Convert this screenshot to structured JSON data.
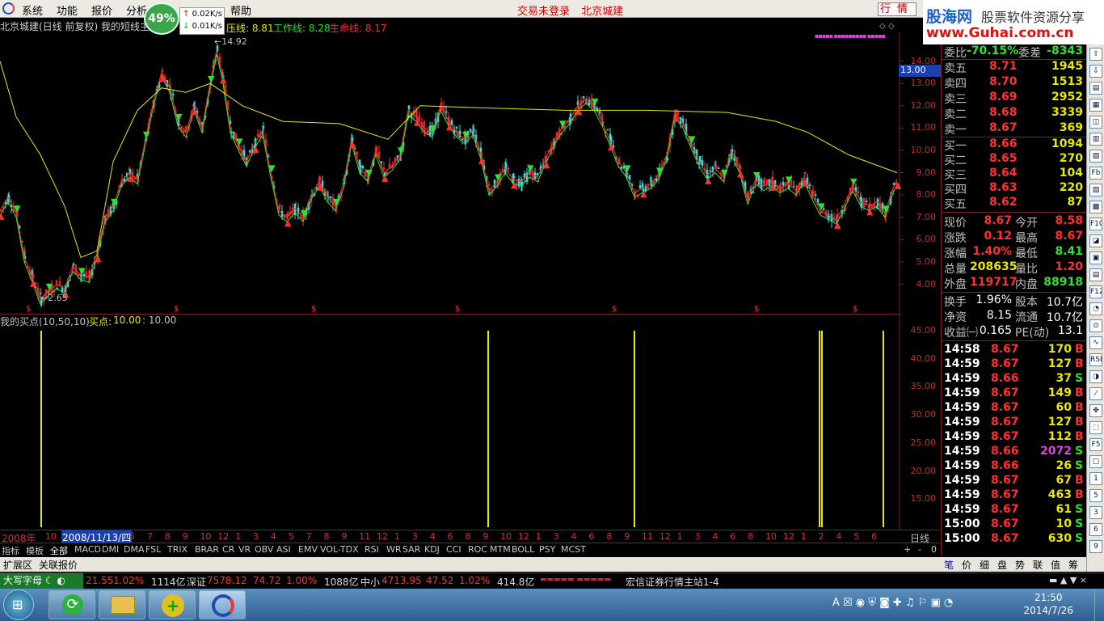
{
  "menu": {
    "items": [
      "系统",
      "功能",
      "报价",
      "分析",
      "帮助"
    ],
    "status_left": "交易未登录",
    "status_right": "北京城建",
    "quote_button": "行情",
    "min": "_",
    "max": "□",
    "close": "×"
  },
  "banner": {
    "brand": "股海网",
    "slogan": "股票软件资源分享",
    "url": "www.Guhai.com.cn"
  },
  "speed": {
    "percent": "49%",
    "up": "0.02K/s",
    "down": "0.01K/s"
  },
  "chart_header": {
    "title": "北京城建(日线 前复权) 我的短线主",
    "l1": "压线: 8.81",
    "l2": "工作线: 8.28",
    "l3": "生命线: 8.17",
    "high_label": "14.92",
    "low_label": "2.65",
    "price_tag": "13.00"
  },
  "price_axis": [
    "14.00",
    "13.00",
    "12.00",
    "11.00",
    "10.00",
    "9.00",
    "8.00",
    "7.00",
    "6.00",
    "5.00",
    "4.00"
  ],
  "indicator": {
    "title": "我的买点(10,50,10)",
    "label": "买点:",
    "value1": "10.00",
    "value2": ": 10.00",
    "axis": [
      "45.00",
      "40.00",
      "35.00",
      "30.00",
      "25.00",
      "20.00",
      "15.00"
    ]
  },
  "timeline": {
    "year": "2008年",
    "selected_date": "2008/11/13/四",
    "labels": [
      "10",
      "5",
      "7",
      "8",
      "9",
      "10",
      "12",
      "1",
      "3",
      "4",
      "5",
      "7",
      "8",
      "9",
      "11",
      "12",
      "1",
      "3",
      "4",
      "6",
      "8",
      "9",
      "10",
      "12",
      "1",
      "3",
      "4",
      "6",
      "8",
      "9",
      "11",
      "12",
      "1",
      "3",
      "4",
      "6",
      "8",
      "10",
      "12",
      "1",
      "2",
      "4",
      "5",
      "6"
    ],
    "period": "日线"
  },
  "weibi": {
    "label1": "委比",
    "val1": "-70.15%",
    "label2": "委差",
    "val2": "-8343"
  },
  "sells": [
    {
      "label": "卖五",
      "price": "8.71",
      "vol": "1945"
    },
    {
      "label": "卖四",
      "price": "8.70",
      "vol": "1513"
    },
    {
      "label": "卖三",
      "price": "8.69",
      "vol": "2952"
    },
    {
      "label": "卖二",
      "price": "8.68",
      "vol": "3339"
    },
    {
      "label": "卖一",
      "price": "8.67",
      "vol": "369"
    }
  ],
  "buys": [
    {
      "label": "买一",
      "price": "8.66",
      "vol": "1094"
    },
    {
      "label": "买二",
      "price": "8.65",
      "vol": "270"
    },
    {
      "label": "买三",
      "price": "8.64",
      "vol": "104"
    },
    {
      "label": "买四",
      "price": "8.63",
      "vol": "220"
    },
    {
      "label": "买五",
      "price": "8.62",
      "vol": "87"
    }
  ],
  "stats": [
    {
      "l1": "现价",
      "v1": "8.67",
      "l2": "今开",
      "v2": "8.58"
    },
    {
      "l1": "涨跌",
      "v1": "0.12",
      "l2": "最高",
      "v2": "8.67"
    },
    {
      "l1": "涨幅",
      "v1": "1.40%",
      "l2": "最低",
      "v2": "8.41"
    },
    {
      "l1": "总量",
      "v1": "208635",
      "l2": "量比",
      "v2": "1.20"
    },
    {
      "l1": "外盘",
      "v1": "119717",
      "l2": "内盘",
      "v2": "88918"
    }
  ],
  "stats2": [
    {
      "l1": "换手",
      "v1": "1.96%",
      "l2": "股本",
      "v2": "10.7亿"
    },
    {
      "l1": "净资",
      "v1": "8.15",
      "l2": "流通",
      "v2": "10.7亿"
    },
    {
      "l1": "收益㈠",
      "v1": "0.165",
      "l2": "PE(动)",
      "v2": "13.1"
    }
  ],
  "ticks": [
    {
      "t": "14:58",
      "p": "8.67",
      "v": "170",
      "s": "B"
    },
    {
      "t": "14:59",
      "p": "8.67",
      "v": "127",
      "s": "B"
    },
    {
      "t": "14:59",
      "p": "8.66",
      "v": "37",
      "s": "S"
    },
    {
      "t": "14:59",
      "p": "8.67",
      "v": "149",
      "s": "B"
    },
    {
      "t": "14:59",
      "p": "8.67",
      "v": "60",
      "s": "B"
    },
    {
      "t": "14:59",
      "p": "8.67",
      "v": "127",
      "s": "B"
    },
    {
      "t": "14:59",
      "p": "8.67",
      "v": "112",
      "s": "B"
    },
    {
      "t": "14:59",
      "p": "8.66",
      "v": "2072",
      "s": "S"
    },
    {
      "t": "14:59",
      "p": "8.66",
      "v": "26",
      "s": "S"
    },
    {
      "t": "14:59",
      "p": "8.67",
      "v": "67",
      "s": "B"
    },
    {
      "t": "14:59",
      "p": "8.67",
      "v": "463",
      "s": "B"
    },
    {
      "t": "14:59",
      "p": "8.67",
      "v": "61",
      "s": "S"
    },
    {
      "t": "15:00",
      "p": "8.67",
      "v": "10",
      "s": "S"
    },
    {
      "t": "15:00",
      "p": "8.67",
      "v": "630",
      "s": "S"
    }
  ],
  "indicator_tabs": [
    "指标",
    "模板",
    "全部",
    "MACD",
    "DMI",
    "DMA",
    "FSL",
    "TRIX",
    "BRAR",
    "CR",
    "VR",
    "OBV",
    "ASI",
    "EMV",
    "VOL-TDX",
    "RSI",
    "WR",
    "SAR",
    "KDJ",
    "CCI",
    "ROC",
    "MTM",
    "BOLL",
    "PSY",
    "MCST"
  ],
  "ext_tabs": [
    "扩展区",
    "关联报价"
  ],
  "right_tabs": [
    "笔",
    "价",
    "细",
    "盘",
    "势",
    "联",
    "值",
    "筹"
  ],
  "tool_icons": [
    "⇧",
    "⇩",
    "▤",
    "▦",
    "◫",
    "▥",
    "▧",
    "Fb",
    "▨",
    "▩",
    "F10",
    "◪",
    "▣",
    "▤",
    "F12",
    "◔",
    "⊙",
    "∿",
    "RSI",
    "◑",
    "⁄",
    "✥",
    "⬚",
    "F5",
    "▢",
    "1",
    "5",
    "3",
    "6",
    "9"
  ],
  "ticker": {
    "ime": "大写字母",
    "segments": [
      {
        "label": "",
        "value": "21.55",
        "chg": "",
        "pct": "1.02%",
        "amt": "1114亿"
      },
      {
        "label": "深证",
        "value": "7578.12",
        "chg": "74.72",
        "pct": "1.00%",
        "amt": "1088亿"
      },
      {
        "label": "中小",
        "value": "4713.95",
        "chg": "47.52",
        "pct": "1.02%",
        "amt": "414.8亿"
      }
    ],
    "server": "宏信证券行情主站1-4"
  },
  "taskbar": {
    "time": "21:50",
    "date": "2014/7/26"
  },
  "chart_data": {
    "type": "candlestick",
    "ylim": [
      2.5,
      15.0
    ],
    "indicator_ylim": [
      10,
      47
    ],
    "ma_long": [
      [
        0,
        14.0
      ],
      [
        20,
        11.5
      ],
      [
        50,
        9.8
      ],
      [
        80,
        7.5
      ],
      [
        100,
        5.2
      ],
      [
        120,
        5.5
      ],
      [
        140,
        9.5
      ],
      [
        170,
        11.8
      ],
      [
        200,
        12.8
      ],
      [
        230,
        12.6
      ],
      [
        260,
        13.0
      ],
      [
        300,
        12.0
      ],
      [
        350,
        11.3
      ],
      [
        420,
        11.2
      ],
      [
        480,
        10.5
      ],
      [
        520,
        12.0
      ],
      [
        600,
        11.9
      ],
      [
        700,
        11.8
      ],
      [
        800,
        11.8
      ],
      [
        900,
        11.7
      ],
      [
        960,
        11.3
      ],
      [
        1000,
        10.8
      ],
      [
        1050,
        9.8
      ],
      [
        1110,
        9.0
      ]
    ],
    "price_series": [
      [
        0,
        7.3
      ],
      [
        10,
        7.9
      ],
      [
        20,
        7.2
      ],
      [
        30,
        5.2
      ],
      [
        40,
        4.3
      ],
      [
        50,
        3.3
      ],
      [
        60,
        3.7
      ],
      [
        70,
        4.0
      ],
      [
        80,
        3.8
      ],
      [
        90,
        4.8
      ],
      [
        100,
        4.4
      ],
      [
        110,
        4.3
      ],
      [
        120,
        5.4
      ],
      [
        130,
        7.0
      ],
      [
        140,
        7.5
      ],
      [
        150,
        8.6
      ],
      [
        160,
        9.0
      ],
      [
        170,
        8.7
      ],
      [
        180,
        10.5
      ],
      [
        190,
        12.2
      ],
      [
        200,
        13.5
      ],
      [
        210,
        12.8
      ],
      [
        220,
        11.3
      ],
      [
        230,
        10.8
      ],
      [
        240,
        12.0
      ],
      [
        250,
        11.0
      ],
      [
        260,
        13.0
      ],
      [
        268,
        14.5
      ],
      [
        275,
        13.4
      ],
      [
        285,
        11.0
      ],
      [
        295,
        10.2
      ],
      [
        305,
        9.5
      ],
      [
        315,
        10.3
      ],
      [
        325,
        10.9
      ],
      [
        335,
        9.0
      ],
      [
        345,
        7.3
      ],
      [
        355,
        7.0
      ],
      [
        365,
        7.4
      ],
      [
        375,
        7.0
      ],
      [
        385,
        8.0
      ],
      [
        395,
        8.6
      ],
      [
        405,
        7.9
      ],
      [
        415,
        7.5
      ],
      [
        425,
        8.5
      ],
      [
        435,
        10.5
      ],
      [
        445,
        9.2
      ],
      [
        455,
        8.8
      ],
      [
        465,
        10.0
      ],
      [
        475,
        9.0
      ],
      [
        485,
        9.3
      ],
      [
        495,
        9.8
      ],
      [
        505,
        11.8
      ],
      [
        515,
        11.5
      ],
      [
        525,
        11.0
      ],
      [
        535,
        10.8
      ],
      [
        545,
        12.0
      ],
      [
        555,
        11.3
      ],
      [
        565,
        10.8
      ],
      [
        575,
        10.5
      ],
      [
        585,
        10.9
      ],
      [
        595,
        9.8
      ],
      [
        605,
        8.2
      ],
      [
        615,
        8.6
      ],
      [
        625,
        9.2
      ],
      [
        635,
        8.7
      ],
      [
        645,
        8.6
      ],
      [
        655,
        9.0
      ],
      [
        665,
        8.8
      ],
      [
        675,
        9.6
      ],
      [
        685,
        10.4
      ],
      [
        695,
        11.0
      ],
      [
        705,
        11.4
      ],
      [
        715,
        12.0
      ],
      [
        725,
        12.3
      ],
      [
        735,
        12.0
      ],
      [
        745,
        11.3
      ],
      [
        755,
        10.4
      ],
      [
        765,
        9.5
      ],
      [
        775,
        9.0
      ],
      [
        785,
        8.1
      ],
      [
        795,
        8.3
      ],
      [
        805,
        8.5
      ],
      [
        815,
        8.9
      ],
      [
        825,
        9.8
      ],
      [
        835,
        11.7
      ],
      [
        845,
        11.2
      ],
      [
        855,
        10.3
      ],
      [
        865,
        9.5
      ],
      [
        875,
        8.9
      ],
      [
        885,
        9.2
      ],
      [
        895,
        8.8
      ],
      [
        905,
        10.0
      ],
      [
        915,
        9.2
      ],
      [
        925,
        7.8
      ],
      [
        935,
        8.7
      ],
      [
        945,
        8.4
      ],
      [
        955,
        8.6
      ],
      [
        965,
        8.3
      ],
      [
        975,
        8.5
      ],
      [
        985,
        8.2
      ],
      [
        995,
        8.8
      ],
      [
        1005,
        8.0
      ],
      [
        1015,
        7.3
      ],
      [
        1025,
        7.1
      ],
      [
        1035,
        6.9
      ],
      [
        1045,
        7.6
      ],
      [
        1055,
        8.4
      ],
      [
        1065,
        7.7
      ],
      [
        1075,
        7.5
      ],
      [
        1085,
        7.7
      ],
      [
        1095,
        7.2
      ],
      [
        1105,
        8.3
      ],
      [
        1110,
        8.67
      ]
    ],
    "buy_signals_x": [
      50,
      603,
      784,
      1013,
      1016,
      1092
    ],
    "buy_signals_value": [
      45,
      45,
      45,
      45,
      45,
      45
    ]
  }
}
